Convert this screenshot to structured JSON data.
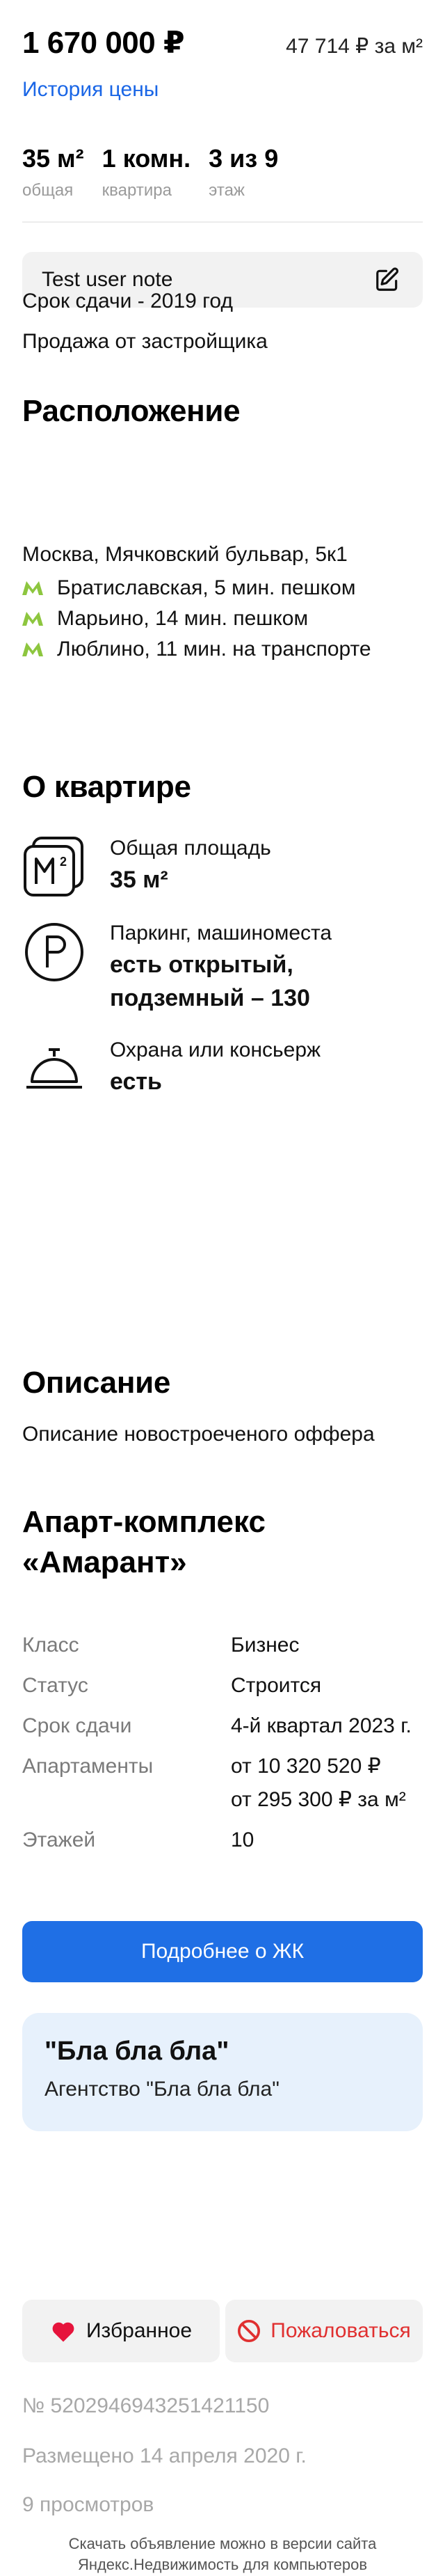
{
  "offer": {
    "price": "1 670 000 ₽",
    "price_per_m2": "47 714 ₽ за м²",
    "price_history_label": "История цены",
    "params": [
      {
        "value": "35 м²",
        "label": "общая"
      },
      {
        "value": "1 комн.",
        "label": "квартира"
      },
      {
        "value": "3 из 9",
        "label": "этаж"
      }
    ],
    "user_note": "Test user note",
    "deadline_text": "Срок сдачи - 2019 год",
    "seller_text": "Продажа от застройщика"
  },
  "location": {
    "heading": "Расположение",
    "address": "Москва, Мячковский бульвар, 5к1",
    "metro": [
      {
        "text": "Братиславская, 5 мин. пешком"
      },
      {
        "text": "Марьино, 14 мин. пешком"
      },
      {
        "text": "Люблино, 11 мин. на транспорте"
      }
    ],
    "metro_color": "#8dc63f"
  },
  "about": {
    "heading": "О квартире",
    "features": [
      {
        "icon": "area-icon",
        "title": "Общая площадь",
        "value": "35 м²"
      },
      {
        "icon": "parking-icon",
        "title": "Паркинг, машиноместа",
        "value": "есть открытый, подземный – 130"
      },
      {
        "icon": "concierge-bell-icon",
        "title": "Охрана или консьерж",
        "value": "есть"
      }
    ]
  },
  "description": {
    "heading": "Описание",
    "text": "Описание новостроеченого оффера"
  },
  "complex": {
    "title": "Апарт-комплекс «Амарант»",
    "specs": [
      {
        "key": "Класс",
        "values": [
          "Бизнес"
        ]
      },
      {
        "key": "Статус",
        "values": [
          "Строится"
        ]
      },
      {
        "key": "Срок сдачи",
        "values": [
          "4-й квартал 2023 г."
        ]
      },
      {
        "key": "Апартаменты",
        "values": [
          "от 10 320 520 ₽",
          "от 295 300 ₽ за м²"
        ]
      },
      {
        "key": "Этажей",
        "values": [
          "10"
        ]
      }
    ],
    "button_label": "Подробнее о ЖК"
  },
  "agency": {
    "name": "\"Бла бла бла\"",
    "subtitle": "Агентство \"Бла бла бла\""
  },
  "actions": {
    "favorite_label": "Избранное",
    "report_label": "Пожаловаться"
  },
  "meta": {
    "offer_id": "№ 5202946943251421150",
    "published": "Размещено 14 апреля 2020 г.",
    "views": "9 просмотров",
    "footer_note": "Скачать объявление можно в версии сайта Яндекс.Недвижимость для компьютеров"
  },
  "colors": {
    "accent": "#1f6fe5",
    "link": "#1a66e6",
    "favorite": "#e6143c",
    "report": "#e03030",
    "agency_bg": "#e7f1fc"
  }
}
